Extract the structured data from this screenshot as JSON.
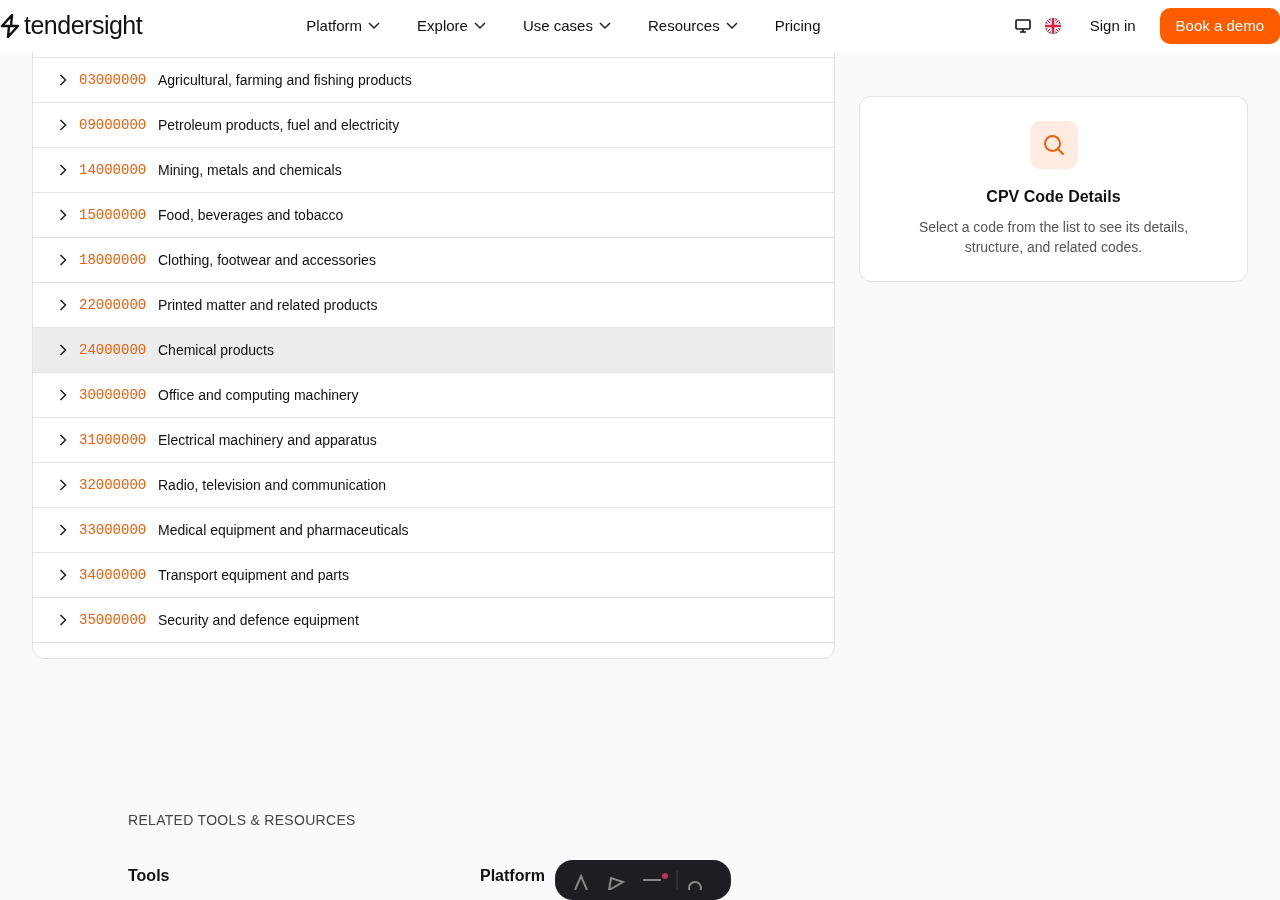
{
  "header": {
    "logo": "tendersight",
    "nav": [
      {
        "label": "Platform",
        "dropdown": true
      },
      {
        "label": "Explore",
        "dropdown": true
      },
      {
        "label": "Use cases",
        "dropdown": true
      },
      {
        "label": "Resources",
        "dropdown": true
      },
      {
        "label": "Pricing",
        "dropdown": false
      }
    ],
    "sign_in": "Sign in",
    "cta": "Book a demo"
  },
  "codes": [
    {
      "code": "03000000",
      "label": "Agricultural, farming and fishing products",
      "selected": false
    },
    {
      "code": "09000000",
      "label": "Petroleum products, fuel and electricity",
      "selected": false
    },
    {
      "code": "14000000",
      "label": "Mining, metals and chemicals",
      "selected": false
    },
    {
      "code": "15000000",
      "label": "Food, beverages and tobacco",
      "selected": false
    },
    {
      "code": "18000000",
      "label": "Clothing, footwear and accessories",
      "selected": false
    },
    {
      "code": "22000000",
      "label": "Printed matter and related products",
      "selected": false
    },
    {
      "code": "24000000",
      "label": "Chemical products",
      "selected": true
    },
    {
      "code": "30000000",
      "label": "Office and computing machinery",
      "selected": false
    },
    {
      "code": "31000000",
      "label": "Electrical machinery and apparatus",
      "selected": false
    },
    {
      "code": "32000000",
      "label": "Radio, television and communication",
      "selected": false
    },
    {
      "code": "33000000",
      "label": "Medical equipment and pharmaceuticals",
      "selected": false
    },
    {
      "code": "34000000",
      "label": "Transport equipment and parts",
      "selected": false
    },
    {
      "code": "35000000",
      "label": "Security and defence equipment",
      "selected": false
    }
  ],
  "details": {
    "title": "CPV Code Details",
    "text": "Select a code from the list to see its details, structure, and related codes."
  },
  "related": {
    "heading": "RELATED TOOLS & RESOURCES",
    "columns": [
      "Tools",
      "Platform"
    ]
  }
}
